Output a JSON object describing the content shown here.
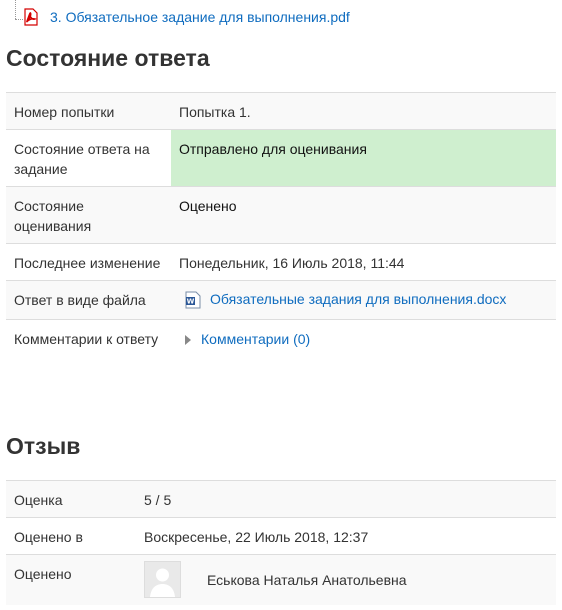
{
  "file": {
    "name": "3. Обязательное задание для выполнения.pdf",
    "icon": "pdf-icon"
  },
  "submission_status": {
    "title": "Состояние ответа",
    "rows": {
      "attempt": {
        "label": "Номер попытки",
        "value": "Попытка 1."
      },
      "status": {
        "label": "Состояние ответа на задание",
        "value": "Отправлено для оценивания"
      },
      "grading": {
        "label": "Состояние оценивания",
        "value": "Оценено"
      },
      "modified": {
        "label": "Последнее изменение",
        "value": "Понедельник, 16 Июль 2018, 11:44"
      },
      "file_submission": {
        "label": "Ответ в виде файла",
        "value": "Обязательные задания для выполнения.docx",
        "icon": "word-doc-icon"
      },
      "comments": {
        "label": "Комментарии к ответу",
        "value": "Комментарии (0)"
      }
    },
    "status_color": "#cfefcf"
  },
  "feedback": {
    "title": "Отзыв",
    "rows": {
      "grade": {
        "label": "Оценка",
        "value": "5 / 5"
      },
      "graded_on": {
        "label": "Оценено в",
        "value": "Воскресенье, 22 Июль 2018, 12:37"
      },
      "graded_by": {
        "label": "Оценено",
        "value": "Еськова Наталья Анатольевна",
        "icon": "avatar"
      }
    }
  },
  "colors": {
    "link": "#0f6cbf",
    "text": "#333333",
    "row_alt": "#f9f9f9",
    "border": "#dddddd"
  }
}
